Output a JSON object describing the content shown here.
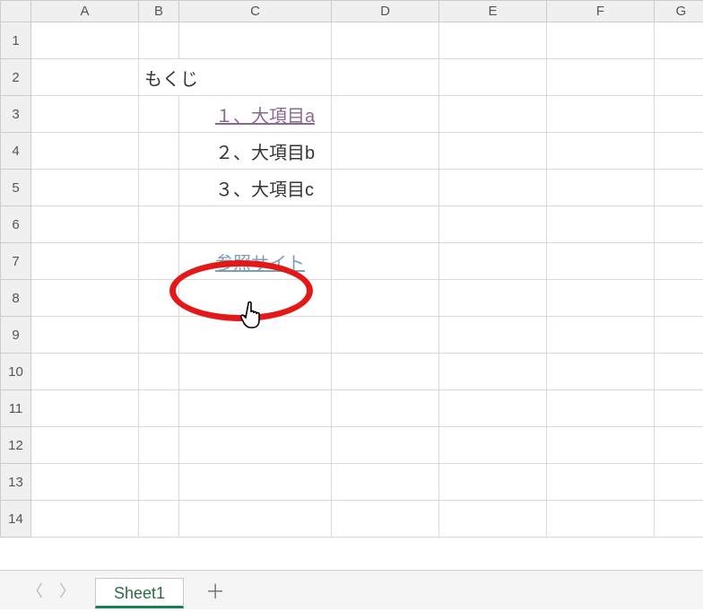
{
  "columns": [
    "A",
    "B",
    "C",
    "D",
    "E",
    "F",
    "G"
  ],
  "rows": [
    "1",
    "2",
    "3",
    "4",
    "5",
    "6",
    "7",
    "8",
    "9",
    "10",
    "11",
    "12",
    "13",
    "14"
  ],
  "cells": {
    "B2_title": "もくじ",
    "C3_link": "１、大項目a",
    "C4": "２、大項目b",
    "C5": "３、大項目c",
    "C7_link": "参照サイト"
  },
  "tabbar": {
    "sheet1": "Sheet1",
    "add": "＋",
    "prev": "〈",
    "next": "〉"
  }
}
